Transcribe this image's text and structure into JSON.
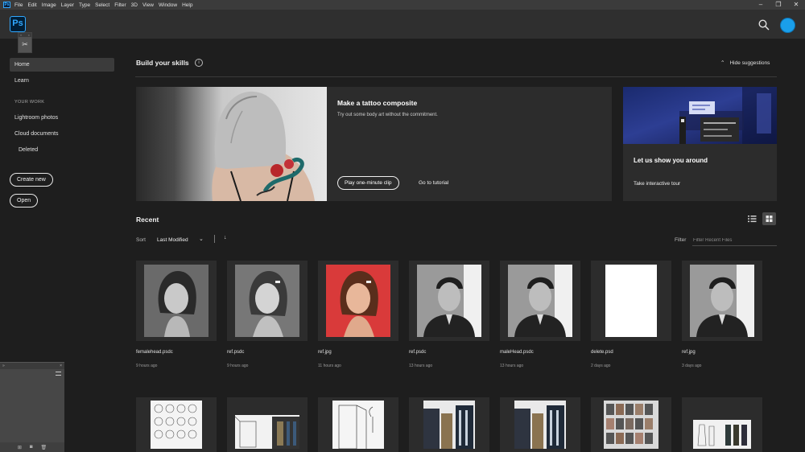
{
  "menubar": {
    "items": [
      "File",
      "Edit",
      "Image",
      "Layer",
      "Type",
      "Select",
      "Filter",
      "3D",
      "View",
      "Window",
      "Help"
    ]
  },
  "app": {
    "logo_text": "Ps"
  },
  "sidebar": {
    "items": [
      {
        "label": "Home",
        "active": true
      },
      {
        "label": "Learn"
      }
    ],
    "section_label": "YOUR WORK",
    "work_items": [
      {
        "label": "Lightroom photos"
      },
      {
        "label": "Cloud documents"
      },
      {
        "label": "Deleted"
      }
    ],
    "create_new": "Create new",
    "open": "Open"
  },
  "skills": {
    "title": "Build your skills",
    "hide_label": "Hide suggestions",
    "main_card": {
      "title": "Make a tattoo composite",
      "description": "Try out some body art without the commitment.",
      "clip_button": "Play one-minute clip",
      "tutorial_link": "Go to tutorial"
    },
    "tour_card": {
      "title": "Let us show you around",
      "link": "Take interactive tour"
    }
  },
  "recent": {
    "title": "Recent",
    "sort_label": "Sort",
    "sort_value": "Last Modified",
    "filter_label": "Filter",
    "filter_placeholder": "Filter Recent Files",
    "files": [
      {
        "name": "femalehead.psdc",
        "time": "9 hours ago",
        "thumb": "woman-gray"
      },
      {
        "name": "ref.psdc",
        "time": "9 hours ago",
        "thumb": "woman-gray-2"
      },
      {
        "name": "ref.jpg",
        "time": "11 hours ago",
        "thumb": "woman-red"
      },
      {
        "name": "ref.psdc",
        "time": "13 hours ago",
        "thumb": "man-bw"
      },
      {
        "name": "maleHead.psdc",
        "time": "13 hours ago",
        "thumb": "man-bw"
      },
      {
        "name": "delete.psd",
        "time": "2 days ago",
        "thumb": "blank"
      },
      {
        "name": "ref.jpg",
        "time": "3 days ago",
        "thumb": "man-bw"
      }
    ],
    "second_row": [
      "sketch-sheet",
      "interior-sketch",
      "door-sketch",
      "interior-color",
      "interior-color",
      "collage",
      "fashion-sheet"
    ]
  },
  "colors": {
    "accent": "#31a8ff",
    "avatar": "#1a9fea",
    "red_bg": "#d93a3a"
  }
}
